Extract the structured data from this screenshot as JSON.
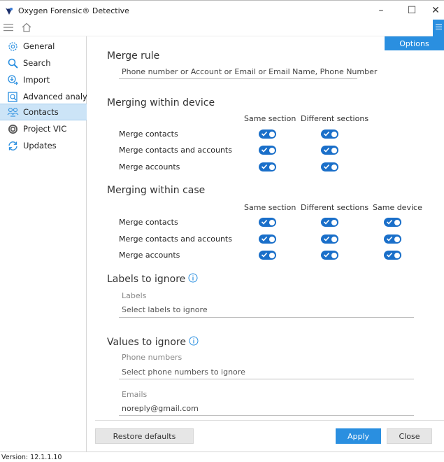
{
  "window": {
    "title": "Oxygen Forensic® Detective",
    "minimize": "–",
    "maximize": "☐",
    "close": "✕"
  },
  "sidebar": {
    "items": [
      {
        "label": "General",
        "icon": "gear-icon"
      },
      {
        "label": "Search",
        "icon": "search-icon"
      },
      {
        "label": "Import",
        "icon": "import-icon"
      },
      {
        "label": "Advanced analytics",
        "icon": "analytics-icon"
      },
      {
        "label": "Contacts",
        "icon": "contacts-icon",
        "active": true
      },
      {
        "label": "Project VIC",
        "icon": "project-vic-icon"
      },
      {
        "label": "Updates",
        "icon": "refresh-icon"
      }
    ]
  },
  "main": {
    "options_tab": "Options",
    "merge_rule": {
      "title": "Merge rule",
      "value": "Phone number or Account or Email or Email Name, Phone Number"
    },
    "within_device": {
      "title": "Merging within device",
      "columns": [
        "Same section",
        "Different sections"
      ],
      "rows": [
        "Merge contacts",
        "Merge contacts and accounts",
        "Merge accounts"
      ]
    },
    "within_case": {
      "title": "Merging within case",
      "columns": [
        "Same section",
        "Different sections",
        "Same device"
      ],
      "rows": [
        "Merge contacts",
        "Merge contacts and accounts",
        "Merge accounts"
      ]
    },
    "labels_ignore": {
      "title": "Labels to ignore",
      "field_label": "Labels",
      "placeholder": "Select labels to ignore"
    },
    "values_ignore": {
      "title": "Values to ignore",
      "phone_label": "Phone numbers",
      "phone_placeholder": "Select phone numbers to ignore",
      "email_label": "Emails",
      "email_value": "noreply@gmail.com"
    },
    "buttons": {
      "restore": "Restore defaults",
      "apply": "Apply",
      "close": "Close"
    }
  },
  "status": {
    "version": "Version: 12.1.1.10"
  },
  "colors": {
    "accent": "#2a8fe0",
    "toggle_on": "#1a6fc9",
    "active_nav": "#cce4f7"
  }
}
